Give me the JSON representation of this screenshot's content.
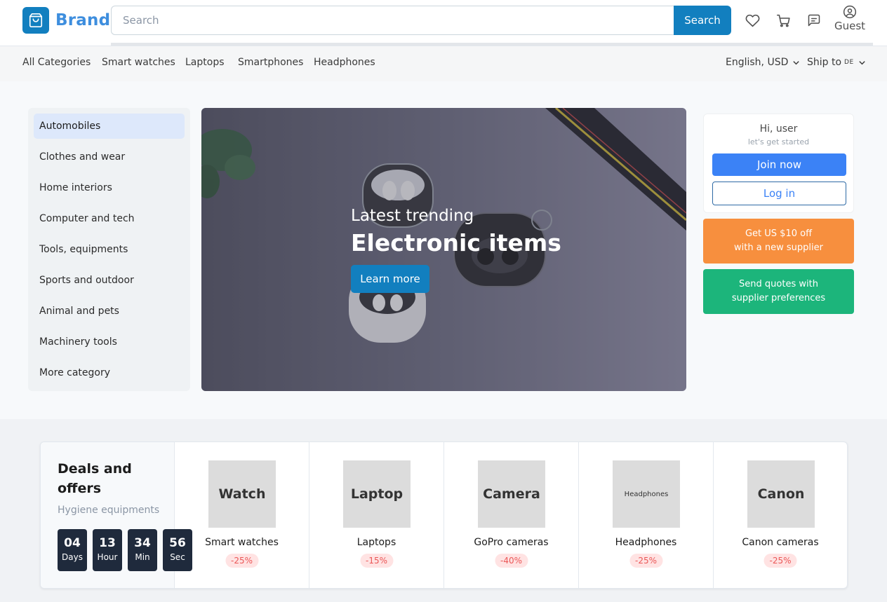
{
  "header": {
    "brand": "Brand",
    "search_placeholder": "Search",
    "search_button": "Search",
    "guest_label": "Guest"
  },
  "nav": {
    "items": [
      "All Categories",
      "Smart watches",
      "Laptops",
      "Smartphones",
      "Headphones"
    ],
    "language": "English, USD",
    "ship_to": "Ship to",
    "ship_country": "DE"
  },
  "categories": [
    "Automobiles",
    "Clothes and wear",
    "Home interiors",
    "Computer and tech",
    "Tools, equipments",
    "Sports and outdoor",
    "Animal and pets",
    "Machinery tools",
    "More category"
  ],
  "banner": {
    "subtitle": "Latest trending",
    "title": "Electronic items",
    "button": "Learn more"
  },
  "user_card": {
    "greeting": "Hi, user",
    "tagline": "let's get started",
    "join": "Join now",
    "login": "Log in"
  },
  "promos": {
    "orange_line1": "Get US $10 off",
    "orange_line2": "with a new supplier",
    "green_line1": "Send quotes with",
    "green_line2": "supplier preferences"
  },
  "deals": {
    "title": "Deals and offers",
    "subtitle": "Hygiene equipments",
    "timer": [
      {
        "value": "04",
        "label": "Days"
      },
      {
        "value": "13",
        "label": "Hour"
      },
      {
        "value": "34",
        "label": "Min"
      },
      {
        "value": "56",
        "label": "Sec"
      }
    ],
    "items": [
      {
        "image_text": "Watch",
        "name": "Smart watches",
        "discount": "-25%"
      },
      {
        "image_text": "Laptop",
        "name": "Laptops",
        "discount": "-15%"
      },
      {
        "image_text": "Camera",
        "name": "GoPro cameras",
        "discount": "-40%"
      },
      {
        "image_text": "Headphones",
        "name": "Headphones",
        "discount": "-25%"
      },
      {
        "image_text": "Canon",
        "name": "Canon cameras",
        "discount": "-25%"
      }
    ]
  },
  "colors": {
    "brand_blue": "#127fbf",
    "join_blue": "#3b82f6",
    "promo_orange": "#f78f3e",
    "promo_green": "#1cb57b",
    "discount_red": "#eb5757"
  }
}
